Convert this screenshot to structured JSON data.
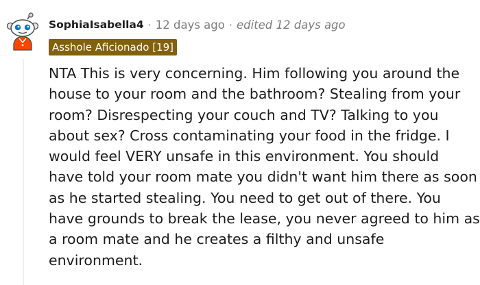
{
  "comment": {
    "username": "SophiaIsabella4",
    "separator": "·",
    "timestamp": "12 days ago",
    "edited_label": "edited 12 days ago",
    "flair": "Asshole Aficionado [19]",
    "body_lines": [
      "NTA This is very concerning. Him following you around the",
      "house to your room and the bathroom? Stealing from your",
      "room? Disrespecting your couch and TV? Talking to you",
      "about sex? Cross contaminating your food in the fridge. I",
      "would feel VERY unsafe in this environment. You should",
      "have told your room mate you didn't want him there as soon",
      "as he started stealing. You need to get out of there. You",
      "have grounds to break the lease, you never agreed to him as",
      "a room mate and he creates a filthy and unsafe",
      "environment."
    ]
  },
  "colors": {
    "flair_background": "#82610d",
    "avatar_shirt": "#ff4500",
    "avatar_eyes": "#0079d3",
    "meta_text": "#7c7c7c",
    "thread_line": "#edeff1"
  },
  "icons": {
    "avatar": "snoo-avatar-icon"
  }
}
